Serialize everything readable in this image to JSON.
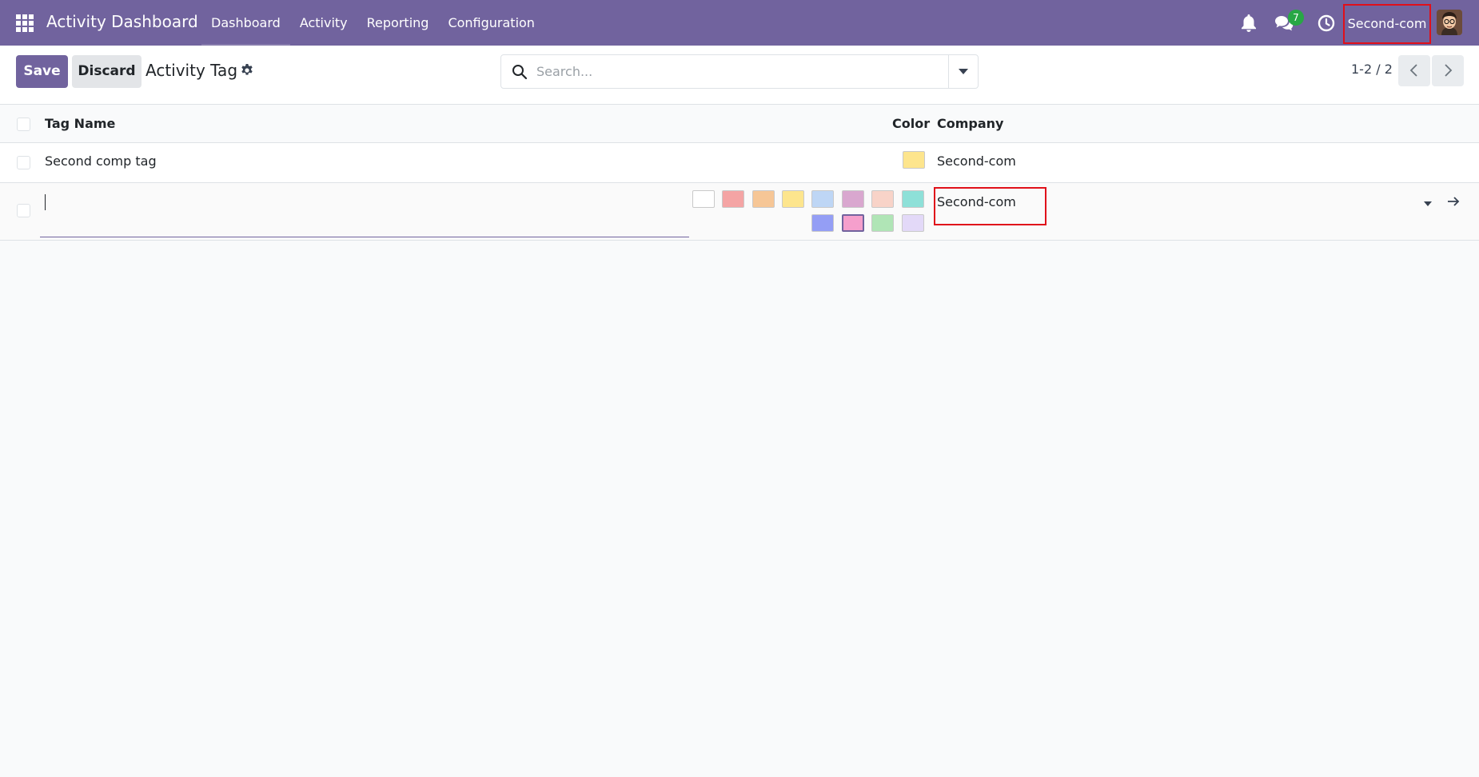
{
  "navbar": {
    "app_title": "Activity Dashboard",
    "menu": [
      "Dashboard",
      "Activity",
      "Reporting",
      "Configuration"
    ],
    "chat_count": "7",
    "company": "Second-com",
    "icons": [
      "apps-grid-icon",
      "bell-icon",
      "chat-icon",
      "clock-icon",
      "avatar"
    ],
    "color": "#71639e"
  },
  "control_panel": {
    "save_label": "Save",
    "discard_label": "Discard",
    "title": "Activity Tag",
    "search_placeholder": "Search...",
    "pager": "1-2 / 2"
  },
  "list": {
    "headers": {
      "name": "Tag Name",
      "color": "Color",
      "company": "Company"
    },
    "rows": [
      {
        "name": "Second comp tag",
        "color": "#fde58d",
        "company": "Second-com"
      }
    ],
    "edit_row": {
      "name": "",
      "company": "Second-com",
      "color_palette": [
        "#ffffff",
        "#f4a4a4",
        "#f6c696",
        "#fde58d",
        "#bed6f5",
        "#d9a7cf",
        "#f8d3c8",
        "#8ee0d8",
        "#949ef5",
        "#f59fcc",
        "#b0e5b6",
        "#e3d9f8"
      ],
      "selected_color": "#f59fcc"
    }
  }
}
